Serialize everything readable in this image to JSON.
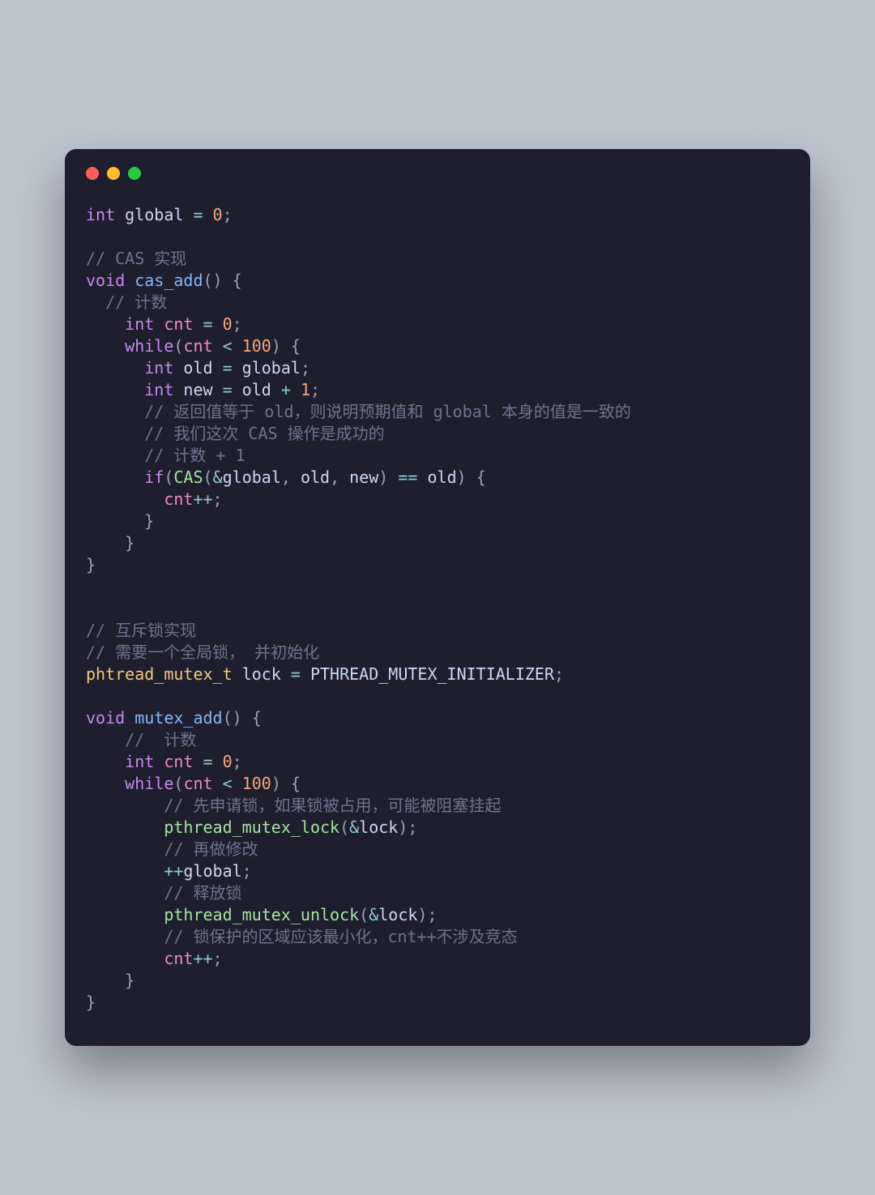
{
  "tokens": [
    [
      [
        "kw",
        "int"
      ],
      [
        "var",
        " global"
      ],
      [
        "op",
        " ="
      ],
      [
        "num",
        " 0"
      ],
      [
        "punc",
        ";"
      ]
    ],
    [],
    [
      [
        "cm",
        "// CAS 实现"
      ]
    ],
    [
      [
        "kw",
        "void"
      ],
      [
        "fn",
        " cas_add"
      ],
      [
        "punc",
        "() {"
      ]
    ],
    [
      [
        "cm",
        "  // 计数"
      ]
    ],
    [
      [
        "var",
        "    "
      ],
      [
        "kw",
        "int"
      ],
      [
        "ident",
        " cnt"
      ],
      [
        "op",
        " ="
      ],
      [
        "num",
        " 0"
      ],
      [
        "punc",
        ";"
      ]
    ],
    [
      [
        "var",
        "    "
      ],
      [
        "kw",
        "while"
      ],
      [
        "punc",
        "("
      ],
      [
        "ident",
        "cnt"
      ],
      [
        "op",
        " < "
      ],
      [
        "num",
        "100"
      ],
      [
        "punc",
        ") {"
      ]
    ],
    [
      [
        "var",
        "      "
      ],
      [
        "kw",
        "int"
      ],
      [
        "var",
        " old"
      ],
      [
        "op",
        " ="
      ],
      [
        "var",
        " global"
      ],
      [
        "punc",
        ";"
      ]
    ],
    [
      [
        "var",
        "      "
      ],
      [
        "kw",
        "int"
      ],
      [
        "var",
        " new"
      ],
      [
        "op",
        " ="
      ],
      [
        "var",
        " old"
      ],
      [
        "op",
        " + "
      ],
      [
        "num",
        "1"
      ],
      [
        "punc",
        ";"
      ]
    ],
    [
      [
        "cm",
        "      // 返回值等于 old，则说明预期值和 global 本身的值是一致的"
      ]
    ],
    [
      [
        "cm",
        "      // 我们这次 CAS 操作是成功的"
      ]
    ],
    [
      [
        "cm",
        "      // 计数 + 1"
      ]
    ],
    [
      [
        "var",
        "      "
      ],
      [
        "kw",
        "if"
      ],
      [
        "punc",
        "("
      ],
      [
        "call",
        "CAS"
      ],
      [
        "punc",
        "("
      ],
      [
        "op",
        "&"
      ],
      [
        "var",
        "global"
      ],
      [
        "punc",
        ", "
      ],
      [
        "var",
        "old"
      ],
      [
        "punc",
        ", "
      ],
      [
        "var",
        "new"
      ],
      [
        "punc",
        ")"
      ],
      [
        "op",
        " == "
      ],
      [
        "var",
        "old"
      ],
      [
        "punc",
        ") {"
      ]
    ],
    [
      [
        "var",
        "        "
      ],
      [
        "ident",
        "cnt"
      ],
      [
        "op",
        "++"
      ],
      [
        "punc",
        ";"
      ]
    ],
    [
      [
        "punc",
        "      }"
      ]
    ],
    [
      [
        "punc",
        "    }"
      ]
    ],
    [
      [
        "punc",
        "}"
      ]
    ],
    [],
    [],
    [
      [
        "cm",
        "// 互斥锁实现"
      ]
    ],
    [
      [
        "cm",
        "// 需要一个全局锁， 并初始化"
      ]
    ],
    [
      [
        "type",
        "phtread_mutex_t"
      ],
      [
        "var",
        " lock"
      ],
      [
        "op",
        " ="
      ],
      [
        "var",
        " PTHREAD_MUTEX_INITIALIZER"
      ],
      [
        "punc",
        ";"
      ]
    ],
    [],
    [
      [
        "kw",
        "void"
      ],
      [
        "fn",
        " mutex_add"
      ],
      [
        "punc",
        "() {"
      ]
    ],
    [
      [
        "cm",
        "    //  计数"
      ]
    ],
    [
      [
        "var",
        "    "
      ],
      [
        "kw",
        "int"
      ],
      [
        "ident",
        " cnt"
      ],
      [
        "op",
        " ="
      ],
      [
        "num",
        " 0"
      ],
      [
        "punc",
        ";"
      ]
    ],
    [
      [
        "var",
        "    "
      ],
      [
        "kw",
        "while"
      ],
      [
        "punc",
        "("
      ],
      [
        "ident",
        "cnt"
      ],
      [
        "op",
        " < "
      ],
      [
        "num",
        "100"
      ],
      [
        "punc",
        ") {"
      ]
    ],
    [
      [
        "cm",
        "        // 先申请锁，如果锁被占用，可能被阻塞挂起"
      ]
    ],
    [
      [
        "var",
        "        "
      ],
      [
        "call",
        "pthread_mutex_lock"
      ],
      [
        "punc",
        "("
      ],
      [
        "op",
        "&"
      ],
      [
        "var",
        "lock"
      ],
      [
        "punc",
        ");"
      ]
    ],
    [
      [
        "cm",
        "        // 再做修改"
      ]
    ],
    [
      [
        "var",
        "        "
      ],
      [
        "op",
        "++"
      ],
      [
        "var",
        "global"
      ],
      [
        "punc",
        ";"
      ]
    ],
    [
      [
        "cm",
        "        // 释放锁"
      ]
    ],
    [
      [
        "var",
        "        "
      ],
      [
        "call",
        "pthread_mutex_unlock"
      ],
      [
        "punc",
        "("
      ],
      [
        "op",
        "&"
      ],
      [
        "var",
        "lock"
      ],
      [
        "punc",
        ");"
      ]
    ],
    [
      [
        "cm",
        "        // 锁保护的区域应该最小化，cnt++不涉及竞态"
      ]
    ],
    [
      [
        "var",
        "        "
      ],
      [
        "ident",
        "cnt"
      ],
      [
        "op",
        "++"
      ],
      [
        "punc",
        ";"
      ]
    ],
    [
      [
        "punc",
        "    }"
      ]
    ],
    [
      [
        "punc",
        "}"
      ]
    ]
  ]
}
